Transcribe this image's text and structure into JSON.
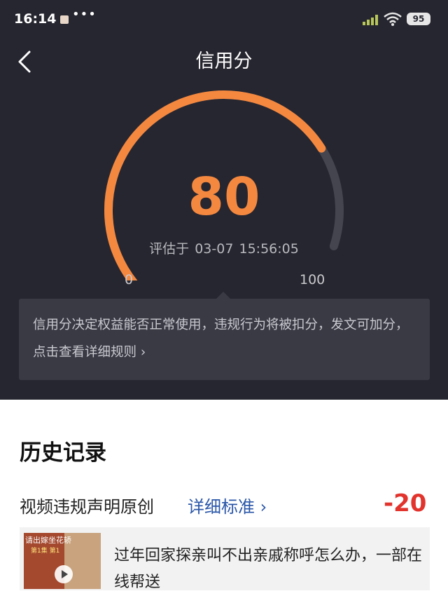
{
  "status_bar": {
    "time": "16:14",
    "more": "•••",
    "battery": "95"
  },
  "header": {
    "title": "信用分"
  },
  "credit": {
    "score": "80",
    "eval_prefix": "评估于",
    "eval_date": "03-07",
    "eval_time": "15:56:05",
    "min_label": "0",
    "max_label": "100",
    "score_fraction": 0.8,
    "accent_color": "#f5883f",
    "track_color": "#45454f"
  },
  "info": {
    "text": "信用分决定权益能否正常使用，违规行为将被扣分，发文可加分，点击查看详细规则 ›"
  },
  "history": {
    "title": "历史记录",
    "records": [
      {
        "name": "视频违规声明原创",
        "link": "详细标准 ›",
        "delta": "-20",
        "thumb_caption": "请出嫁坐花轿",
        "thumb_sub": "第1集 第1",
        "article_title": "过年回家探亲叫不出亲戚称呼怎么办，一部在线帮送"
      }
    ]
  }
}
